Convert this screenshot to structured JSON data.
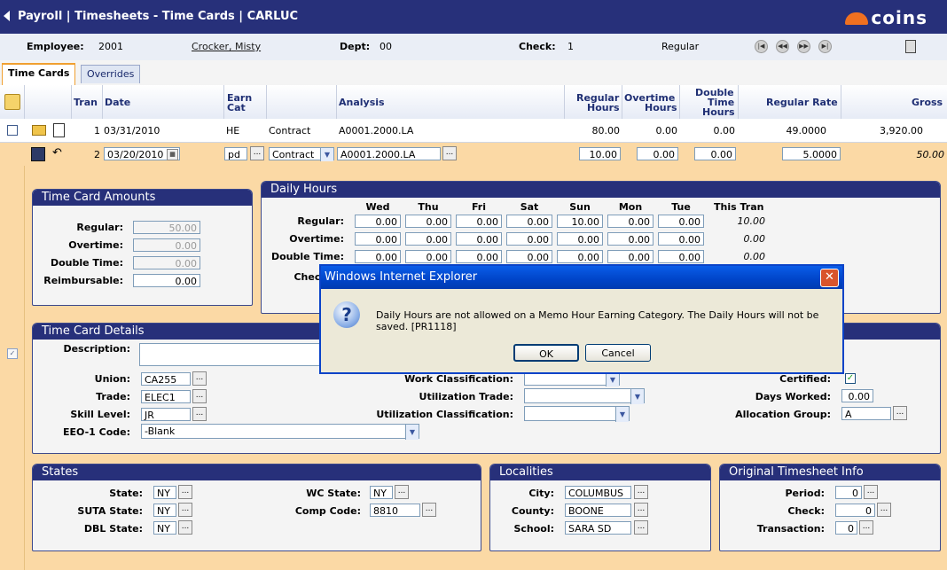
{
  "header": {
    "title": "Payroll | Timesheets - Time Cards | CARLUC",
    "logo_text": "coins",
    "brand_color": "#27307a",
    "accent_color": "#f07020"
  },
  "infobar": {
    "employee_label": "Employee:",
    "employee_id": "2001",
    "employee_name": "Crocker, Misty",
    "dept_label": "Dept:",
    "dept_value": "00",
    "check_label": "Check:",
    "check_value": "1",
    "check_type": "Regular",
    "nav_icons": [
      "first-icon",
      "prev-icon",
      "next-icon",
      "last-icon"
    ],
    "calculator_icon": "calculator-icon"
  },
  "tabs": [
    {
      "label": "Time Cards",
      "active": true
    },
    {
      "label": "Overrides",
      "active": false
    }
  ],
  "grid": {
    "columns": {
      "tran": "Tran",
      "date": "Date",
      "earn_cat_1": "Earn",
      "earn_cat_2": "Cat",
      "analysis": "Analysis",
      "reg_hours_1": "Regular",
      "reg_hours_2": "Hours",
      "ot_hours_1": "Overtime",
      "ot_hours_2": "Hours",
      "dt_hours_1": "Double",
      "dt_hours_2": "Time",
      "dt_hours_3": "Hours",
      "reg_rate": "Regular Rate",
      "gross": "Gross"
    },
    "row1": {
      "tran": "1",
      "date": "03/31/2010",
      "earn_cat": "HE",
      "type": "Contract",
      "analysis": "A0001.2000.LA",
      "reg_hours": "80.00",
      "ot_hours": "0.00",
      "dt_hours": "0.00",
      "reg_rate": "49.0000",
      "gross": "3,920.00"
    },
    "row2": {
      "tran": "2",
      "date": "03/20/2010",
      "earn_cat": "pd",
      "type": "Contract",
      "analysis": "A0001.2000.LA",
      "reg_hours": "10.00",
      "ot_hours": "0.00",
      "dt_hours": "0.00",
      "reg_rate": "5.0000",
      "gross": "50.00"
    }
  },
  "time_card_amounts": {
    "title": "Time Card Amounts",
    "regular_label": "Regular:",
    "regular_value": "50.00",
    "overtime_label": "Overtime:",
    "overtime_value": "0.00",
    "double_label": "Double Time:",
    "double_value": "0.00",
    "reimb_label": "Reimbursable:",
    "reimb_value": "0.00"
  },
  "daily_hours": {
    "title": "Daily Hours",
    "days": [
      "Wed",
      "Thu",
      "Fri",
      "Sat",
      "Sun",
      "Mon",
      "Tue"
    ],
    "this_tran_label": "This Tran",
    "rows": [
      {
        "label": "Regular:",
        "values": [
          "0.00",
          "0.00",
          "0.00",
          "0.00",
          "10.00",
          "0.00",
          "0.00"
        ],
        "total": "10.00"
      },
      {
        "label": "Overtime:",
        "values": [
          "0.00",
          "0.00",
          "0.00",
          "0.00",
          "0.00",
          "0.00",
          "0.00"
        ],
        "total": "0.00"
      },
      {
        "label": "Double Time:",
        "values": [
          "0.00",
          "0.00",
          "0.00",
          "0.00",
          "0.00",
          "0.00",
          "0.00"
        ],
        "total": "0.00"
      }
    ],
    "check_total_label": "Check T"
  },
  "details": {
    "title": "Time Card Details",
    "description_label": "Description:",
    "description_value": "",
    "union_label": "Union:",
    "union_value": "CA255",
    "trade_label": "Trade:",
    "trade_value": "ELEC1",
    "skill_label": "Skill Level:",
    "skill_value": "JR",
    "eeo_label": "EEO-1 Code:",
    "eeo_value": "-Blank",
    "work_class_label": "Work Classification:",
    "util_trade_label": "Utilization Trade:",
    "util_class_label": "Utilization Classification:",
    "certified_label": "Certified:",
    "certified_checked": true,
    "days_worked_label": "Days Worked:",
    "days_worked_value": "0.00",
    "alloc_group_label": "Allocation Group:",
    "alloc_group_value": "A"
  },
  "states": {
    "title": "States",
    "state_label": "State:",
    "state_value": "NY",
    "suta_label": "SUTA State:",
    "suta_value": "NY",
    "dbl_label": "DBL State:",
    "dbl_value": "NY",
    "wc_label": "WC State:",
    "wc_value": "NY",
    "comp_label": "Comp Code:",
    "comp_value": "8810"
  },
  "localities": {
    "title": "Localities",
    "city_label": "City:",
    "city_value": "COLUMBUS",
    "county_label": "County:",
    "county_value": "BOONE",
    "school_label": "School:",
    "school_value": "SARA SD"
  },
  "original": {
    "title": "Original Timesheet Info",
    "period_label": "Period:",
    "period_value": "0",
    "check_label": "Check:",
    "check_value": "0",
    "trans_label": "Transaction:",
    "trans_value": "0"
  },
  "dialog": {
    "title": "Windows Internet Explorer",
    "message": "Daily Hours are not allowed on a Memo Hour Earning Category.  The Daily Hours will not be saved. [PR1118]",
    "ok_label": "OK",
    "cancel_label": "Cancel",
    "icon": "question-icon"
  },
  "dots_label": "..."
}
